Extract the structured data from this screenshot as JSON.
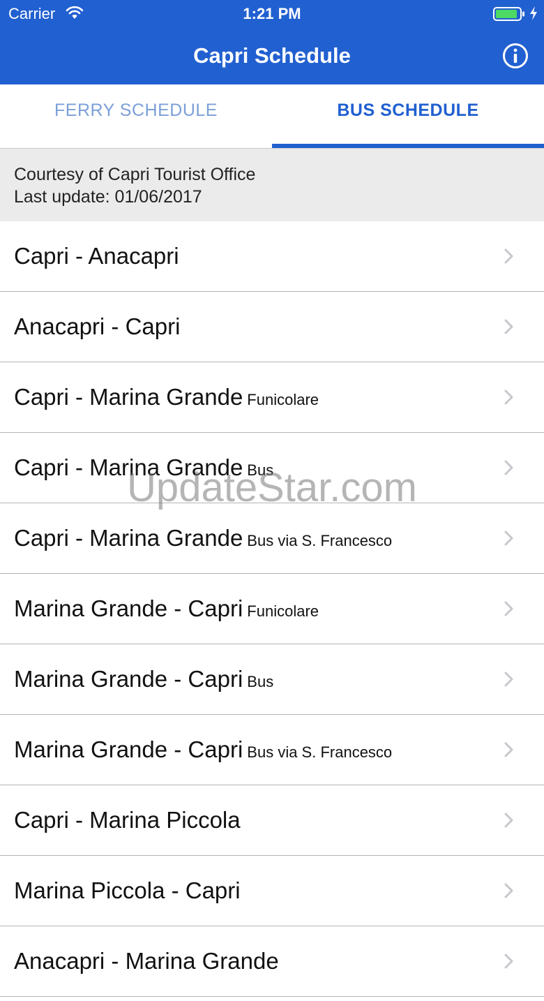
{
  "status_bar": {
    "carrier": "Carrier",
    "time": "1:21 PM",
    "icons": [
      "wifi-icon",
      "battery-icon",
      "charging-icon"
    ]
  },
  "nav": {
    "title": "Capri Schedule",
    "info_icon": "info-icon"
  },
  "tabs": [
    {
      "label": "FERRY SCHEDULE",
      "selected": false
    },
    {
      "label": "BUS SCHEDULE",
      "selected": true
    }
  ],
  "banner": {
    "line1": "Courtesy of Capri Tourist Office",
    "line2": "Last update: 01/06/2017"
  },
  "routes": [
    {
      "name": "Capri - Anacapri",
      "subtitle": ""
    },
    {
      "name": "Anacapri - Capri",
      "subtitle": ""
    },
    {
      "name": "Capri - Marina Grande",
      "subtitle": "Funicolare"
    },
    {
      "name": "Capri - Marina Grande",
      "subtitle": "Bus"
    },
    {
      "name": "Capri - Marina Grande",
      "subtitle": "Bus via S. Francesco"
    },
    {
      "name": "Marina Grande - Capri",
      "subtitle": "Funicolare"
    },
    {
      "name": "Marina Grande - Capri",
      "subtitle": "Bus"
    },
    {
      "name": "Marina Grande - Capri",
      "subtitle": "Bus via S. Francesco"
    },
    {
      "name": "Capri - Marina Piccola",
      "subtitle": ""
    },
    {
      "name": "Marina Piccola - Capri",
      "subtitle": ""
    },
    {
      "name": "Anacapri - Marina Grande",
      "subtitle": ""
    }
  ],
  "watermark": "UpdateStar.com",
  "colors": {
    "primary": "#2160d0",
    "tab_inactive": "#7b9fd8",
    "banner_bg": "#ebebeb",
    "divider": "#b4b4b4",
    "chevron": "#c7c7cc"
  }
}
